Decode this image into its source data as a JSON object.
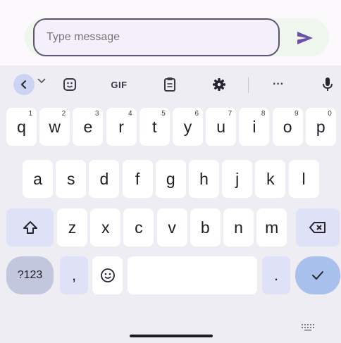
{
  "compose": {
    "placeholder": "Type message"
  },
  "toolbar": {
    "items": [
      "back-arrow",
      "emoji-sticker",
      "gif",
      "clipboard",
      "settings",
      "more",
      "microphone"
    ],
    "gif_label": "GIF",
    "more_label": "···"
  },
  "keyboard": {
    "row1": [
      {
        "k": "q",
        "h": "1"
      },
      {
        "k": "w",
        "h": "2"
      },
      {
        "k": "e",
        "h": "3"
      },
      {
        "k": "r",
        "h": "4"
      },
      {
        "k": "t",
        "h": "5"
      },
      {
        "k": "y",
        "h": "6"
      },
      {
        "k": "u",
        "h": "7"
      },
      {
        "k": "i",
        "h": "8"
      },
      {
        "k": "o",
        "h": "9"
      },
      {
        "k": "p",
        "h": "0"
      }
    ],
    "row2": [
      "a",
      "s",
      "d",
      "f",
      "g",
      "h",
      "j",
      "k",
      "l"
    ],
    "row3": [
      "z",
      "x",
      "c",
      "v",
      "b",
      "n",
      "m"
    ],
    "symbols_label": "?123",
    "comma_label": ",",
    "period_label": "."
  },
  "colors": {
    "accent": "#6b4fa8",
    "func_key": "#dfe2f6",
    "enter_key": "#a8c1ec",
    "symbols_key": "#c3c7dd"
  }
}
